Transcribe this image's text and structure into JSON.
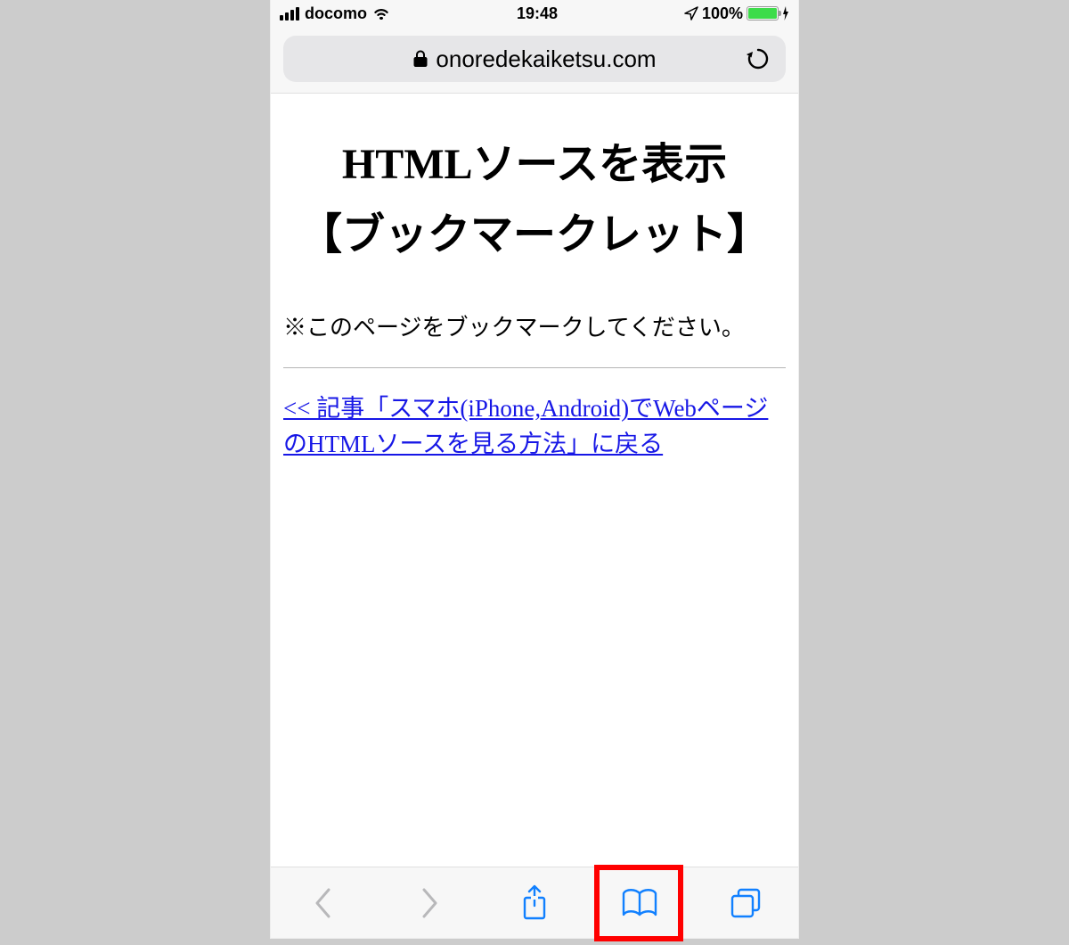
{
  "statusbar": {
    "carrier": "docomo",
    "time": "19:48",
    "battery": "100%"
  },
  "url_bar": {
    "domain": "onoredekaiketsu.com"
  },
  "page": {
    "title_line1": "HTMLソースを表示",
    "title_line2": "【ブックマークレット】",
    "note": "※このページをブックマークしてください。",
    "back_link": "<< 記事「スマホ(iPhone,Android)でWebページのHTMLソースを見る方法」に戻る"
  },
  "toolbar": {
    "back": "back",
    "forward": "forward",
    "share": "share",
    "bookmarks": "bookmarks",
    "tabs": "tabs"
  }
}
